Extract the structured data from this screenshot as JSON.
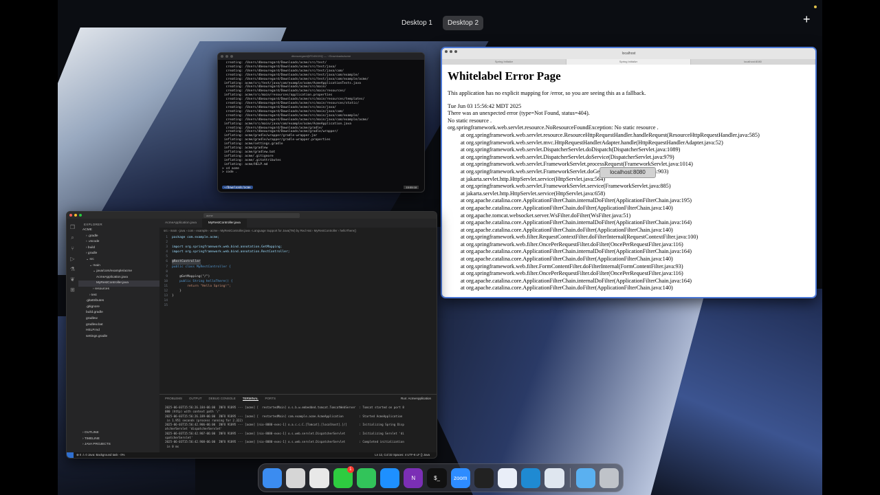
{
  "spaces": {
    "desktop1": "Desktop 1",
    "desktop2": "Desktop 2",
    "add": "+"
  },
  "terminal": {
    "title": "dbeauregard@FD4WJHQ — ~/Downloads/acme",
    "lines": [
      "  creating: /Users/dbeauregard/Downloads/acme/src/test/",
      "  creating: /Users/dbeauregard/Downloads/acme/src/test/java/",
      "  creating: /Users/dbeauregard/Downloads/acme/src/test/java/com/",
      "  creating: /Users/dbeauregard/Downloads/acme/src/test/java/com/example/",
      "  creating: /Users/dbeauregard/Downloads/acme/src/test/java/com/example/acme/",
      " inflating: acme/src/test/java/com/example/acme/AcmeApplicationTests.java",
      "  creating: /Users/dbeauregard/Downloads/acme/src/main/",
      "  creating: /Users/dbeauregard/Downloads/acme/src/main/resources/",
      " inflating: acme/src/main/resources/application.properties",
      "  creating: /Users/dbeauregard/Downloads/acme/src/main/resources/templates/",
      "  creating: /Users/dbeauregard/Downloads/acme/src/main/resources/static/",
      "  creating: /Users/dbeauregard/Downloads/acme/src/main/java/",
      "  creating: /Users/dbeauregard/Downloads/acme/src/main/java/com/",
      "  creating: /Users/dbeauregard/Downloads/acme/src/main/java/com/example/",
      "  creating: /Users/dbeauregard/Downloads/acme/src/main/java/com/example/acme/",
      " inflating: acme/src/main/java/com/example/acme/AcmeApplication.java",
      "  creating: /Users/dbeauregard/Downloads/acme/gradle/",
      "  creating: /Users/dbeauregard/Downloads/acme/gradle/wrapper/",
      " inflating: acme/gradle/wrapper/gradle-wrapper.jar",
      " inflating: acme/gradle/wrapper/gradle-wrapper.properties",
      " inflating: acme/settings.gradle",
      " inflating: acme/gradlew",
      " inflating: acme/gradlew.bat",
      " inflating: acme/.gitignore",
      " inflating: acme/.gitattributes",
      " inflating: acme/HELP.md",
      "> cd acme",
      "> code ."
    ],
    "prompt": "~/Downloads/acme",
    "clock": "15:55:18"
  },
  "browser": {
    "url": "localhost",
    "tabs": [
      "Spring Initializr",
      "Spring Initializr",
      "localhost:8080"
    ],
    "heading": "Whitelabel Error Page",
    "intro": "This application has no explicit mapping for /error, so you are seeing this as a fallback.",
    "timestamp": "Tue Jun 03 15:56:42 MDT 2025",
    "error_line": "There was an unexpected error (type=Not Found, status=404).",
    "no_static": "No static resource .",
    "trace": [
      "org.springframework.web.servlet.resource.NoResourceFoundException: No static resource .",
      "at org.springframework.web.servlet.resource.ResourceHttpRequestHandler.handleRequest(ResourceHttpRequestHandler.java:585)",
      "at org.springframework.web.servlet.mvc.HttpRequestHandlerAdapter.handle(HttpRequestHandlerAdapter.java:52)",
      "at org.springframework.web.servlet.DispatcherServlet.doDispatch(DispatcherServlet.java:1089)",
      "at org.springframework.web.servlet.DispatcherServlet.doService(DispatcherServlet.java:979)",
      "at org.springframework.web.servlet.FrameworkServlet.processRequest(FrameworkServlet.java:1014)",
      "at org.springframework.web.servlet.FrameworkServlet.doGet(FrameworkServlet.java:903)",
      "at jakarta.servlet.http.HttpServlet.service(HttpServlet.java:564)",
      "at org.springframework.web.servlet.FrameworkServlet.service(FrameworkServlet.java:885)",
      "at jakarta.servlet.http.HttpServlet.service(HttpServlet.java:658)",
      "at org.apache.catalina.core.ApplicationFilterChain.internalDoFilter(ApplicationFilterChain.java:195)",
      "at org.apache.catalina.core.ApplicationFilterChain.doFilter(ApplicationFilterChain.java:140)",
      "at org.apache.tomcat.websocket.server.WsFilter.doFilter(WsFilter.java:51)",
      "at org.apache.catalina.core.ApplicationFilterChain.internalDoFilter(ApplicationFilterChain.java:164)",
      "at org.apache.catalina.core.ApplicationFilterChain.doFilter(ApplicationFilterChain.java:140)",
      "at org.springframework.web.filter.RequestContextFilter.doFilterInternal(RequestContextFilter.java:100)",
      "at org.springframework.web.filter.OncePerRequestFilter.doFilter(OncePerRequestFilter.java:116)",
      "at org.apache.catalina.core.ApplicationFilterChain.internalDoFilter(ApplicationFilterChain.java:164)",
      "at org.apache.catalina.core.ApplicationFilterChain.doFilter(ApplicationFilterChain.java:140)",
      "at org.springframework.web.filter.FormContentFilter.doFilterInternal(FormContentFilter.java:93)",
      "at org.springframework.web.filter.OncePerRequestFilter.doFilter(OncePerRequestFilter.java:116)",
      "at org.apache.catalina.core.ApplicationFilterChain.internalDoFilter(ApplicationFilterChain.java:164)",
      "at org.apache.catalina.core.ApplicationFilterChain.doFilter(ApplicationFilterChain.java:140)"
    ],
    "tooltip": "localhost:8080"
  },
  "vscode": {
    "search": "acme",
    "explorer_header": "EXPLORER",
    "tree": [
      {
        "label": "ACME",
        "indent": 0,
        "sel": false
      },
      {
        "label": "› .gradle",
        "indent": 1,
        "sel": false
      },
      {
        "label": "› .vscode",
        "indent": 1,
        "sel": false
      },
      {
        "label": "› build",
        "indent": 1,
        "sel": false
      },
      {
        "label": "› gradle",
        "indent": 1,
        "sel": false
      },
      {
        "label": "⌄ src",
        "indent": 1,
        "sel": false
      },
      {
        "label": "⌄ main",
        "indent": 2,
        "sel": false
      },
      {
        "label": "⌄ java/com/example/acme",
        "indent": 3,
        "sel": false
      },
      {
        "label": "AcmeApplication.java",
        "indent": 4,
        "sel": false
      },
      {
        "label": "MyRestController.java",
        "indent": 4,
        "sel": true
      },
      {
        "label": "› resources",
        "indent": 3,
        "sel": false
      },
      {
        "label": "› test",
        "indent": 2,
        "sel": false
      },
      {
        "label": ".gitattributes",
        "indent": 1,
        "sel": false
      },
      {
        "label": ".gitignore",
        "indent": 1,
        "sel": false
      },
      {
        "label": "build.gradle",
        "indent": 1,
        "sel": false
      },
      {
        "label": "gradlew",
        "indent": 1,
        "sel": false
      },
      {
        "label": "gradlew.bat",
        "indent": 1,
        "sel": false
      },
      {
        "label": "HELP.md",
        "indent": 1,
        "sel": false
      },
      {
        "label": "settings.gradle",
        "indent": 1,
        "sel": false
      }
    ],
    "bottom_sections": [
      "› OUTLINE",
      "› TIMELINE",
      "› JAVA PROJECTS"
    ],
    "tabs": [
      "AcmeApplication.java",
      "MyRestController.java"
    ],
    "breadcrumb": "src › main › java › com › example › acme › MyRestController.java › Language Support for Java(TM) by Red Hat › MyRestController › helloThere()",
    "code": [
      {
        "n": "1",
        "t": "package com.example.acme;"
      },
      {
        "n": "2",
        "t": ""
      },
      {
        "n": "3",
        "t": "import org.springframework.web.bind.annotation.GetMapping;"
      },
      {
        "n": "4",
        "t": "import org.springframework.web.bind.annotation.RestController;"
      },
      {
        "n": "5",
        "t": ""
      },
      {
        "n": "6",
        "t": "@RestController"
      },
      {
        "n": "7",
        "t": "public class MyRestController {"
      },
      {
        "n": "8",
        "t": ""
      },
      {
        "n": "9",
        "t": "    @GetMapping(\"/\")"
      },
      {
        "n": "10",
        "t": "    public String helloThere() {"
      },
      {
        "n": "11",
        "t": "        return \"Hello Spring!\";"
      },
      {
        "n": "12",
        "t": "    }"
      },
      {
        "n": "13",
        "t": "}"
      },
      {
        "n": "14",
        "t": ""
      },
      {
        "n": "15",
        "t": ""
      }
    ],
    "panel_tabs": [
      "PROBLEMS",
      "OUTPUT",
      "DEBUG CONSOLE",
      "TERMINAL",
      "PORTS"
    ],
    "panel_run": "Run: AcmeApplication",
    "panel_log": [
      "2025-06-03T15:56:26.184-06:00  INFO 91895 --- [acme] [  restartedMain] o.s.b.w.embedded.tomcat.TomcatWebServer  : Tomcat started on port 8",
      "080 (http) with context path '/'",
      "2025-06-03T15:56:26.189-06:00  INFO 91895 --- [acme] [  restartedMain] com.example.acme.AcmeApplication         : Started AcmeApplication",
      " in 1.951 seconds (process running for 2.322)",
      "2025-06-03T15:56:42.906-06:00  INFO 91895 --- [acme] [nio-8080-exec-1] o.a.c.c.C.[Tomcat].[localhost].[/]       : Initializing Spring Disp",
      "atcherServlet 'dispatcherServlet'",
      "2025-06-03T15:56:42.907-06:00  INFO 91895 --- [acme] [nio-8080-exec-1] o.s.web.servlet.DispatcherServlet        : Initializing Servlet 'di",
      "spatcherServlet'",
      "2025-06-03T15:56:42.908-06:00  INFO 91895 --- [acme] [nio-8080-exec-1] o.s.web.servlet.DispatcherServlet        : Completed initialization",
      " in 0 ms"
    ],
    "status_left": "⊗ 0 ⚠ 0   Java: Background task - 0%",
    "status_right": "Ln 12, Col 32   Spaces: 4   UTF-8   LF   {} Java"
  },
  "dock": [
    {
      "name": "finder-icon",
      "label": "",
      "color": "#3b8cf0"
    },
    {
      "name": "launchpad-icon",
      "label": "",
      "color": "#d6d6d6"
    },
    {
      "name": "chrome-icon",
      "label": "",
      "color": "#e8e8e8"
    },
    {
      "name": "messages-green-icon",
      "label": "",
      "color": "#2ecc40"
    },
    {
      "name": "messages-icon",
      "label": "",
      "color": "#32c45a"
    },
    {
      "name": "safari-icon",
      "label": "",
      "color": "#1e90ff"
    },
    {
      "name": "onenote-icon",
      "label": "N",
      "color": "#7b2fb5"
    },
    {
      "name": "terminal-icon",
      "label": "$_",
      "color": "#111111"
    },
    {
      "name": "zoom-icon",
      "label": "zoom",
      "color": "#2d8cff"
    },
    {
      "name": "activity-monitor-icon",
      "label": "",
      "color": "#222222"
    },
    {
      "name": "1password-icon",
      "label": "",
      "color": "#e9eef8"
    },
    {
      "name": "vscode-icon",
      "label": "",
      "color": "#1f8ad2"
    },
    {
      "name": "quicktime-icon",
      "label": "",
      "color": "#dfe6ef"
    },
    {
      "name": "downloads-folder-icon",
      "label": "",
      "color": "#5ab0f0"
    },
    {
      "name": "trash-icon",
      "label": "",
      "color": "#bfc3c9"
    }
  ],
  "dock_badge": "1"
}
